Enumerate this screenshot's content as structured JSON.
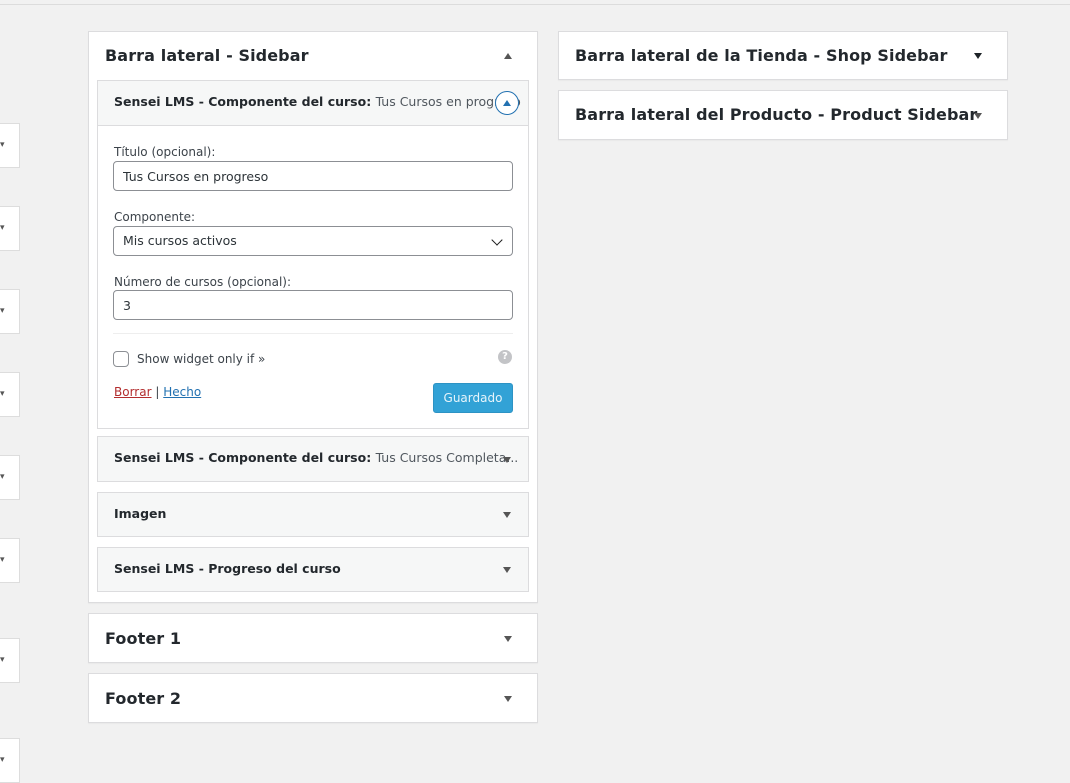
{
  "left_column": {
    "sidebar_panel": {
      "title": "Barra lateral - Sidebar",
      "open_widget": {
        "title_main": "Sensei LMS - Componente del curso:",
        "title_sub": "Tus Cursos en progreso",
        "fields": {
          "title_label": "Título (opcional):",
          "title_value": "Tus Cursos en progreso",
          "component_label": "Componente:",
          "component_value": "Mis cursos activos",
          "count_label": "Número de cursos (opcional):",
          "count_value": "3"
        },
        "show_if_label": "Show widget only if »",
        "help_icon_text": "?",
        "delete_label": "Borrar",
        "separator": "|",
        "done_label": "Hecho",
        "save_label": "Guardado"
      },
      "widgets": [
        {
          "title_main": "Sensei LMS - Componente del curso:",
          "title_sub": "Tus Cursos Completa..."
        },
        {
          "title_main": "Imagen",
          "title_sub": ""
        },
        {
          "title_main": "Sensei LMS - Progreso del curso",
          "title_sub": ""
        }
      ]
    },
    "footer_panels": [
      {
        "title": "Footer 1"
      },
      {
        "title": "Footer 2"
      }
    ]
  },
  "right_column": {
    "panels": [
      {
        "title": "Barra lateral de la Tienda - Shop Sidebar"
      },
      {
        "title": "Barra lateral del Producto - Product Sidebar"
      }
    ]
  },
  "icons": {
    "collapse": "caret-up-icon",
    "expand": "caret-down-icon",
    "select": "chevron-down-icon",
    "help": "help-icon"
  },
  "colors": {
    "background": "#f1f1f1",
    "link": "#2271b1",
    "delete_link": "#b32d2e",
    "primary_button": "#32a2d6"
  }
}
